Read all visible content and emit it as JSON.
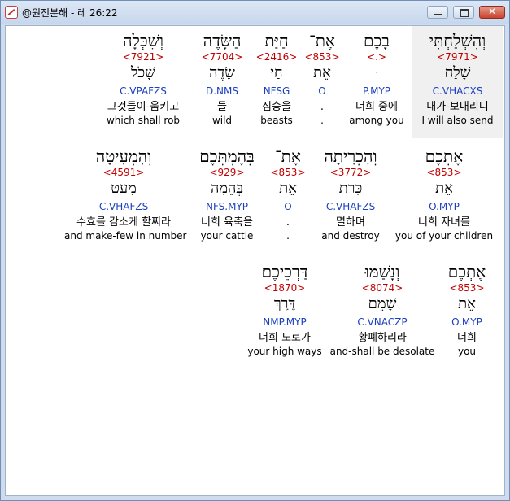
{
  "window": {
    "title": "@원전분해 - 레 26:22",
    "close_label": "✕"
  },
  "rows": [
    {
      "words": [
        {
          "heb": "וְהִשְׁלַחְתִּי",
          "strong": "<7971>",
          "lemma": "שָׁלַח",
          "morph": "C.VHACXS",
          "ko": "내가-보내리니",
          "en": "I will also send"
        },
        {
          "heb": "בָכֶם",
          "strong": "<.>",
          "lemma": "ּ",
          "morph": "P.MYP",
          "ko": "너희 중에",
          "en": "among you"
        },
        {
          "heb": "אֶת־",
          "strong": "<853>",
          "lemma": "אֵת",
          "morph": "O",
          "ko": ".",
          "en": "."
        },
        {
          "heb": "חַיַּת",
          "strong": "<2416>",
          "lemma": "חַי",
          "morph": "NFSG",
          "ko": "짐승을",
          "en": "beasts"
        },
        {
          "heb": "הַשָּׂדֶה",
          "strong": "<7704>",
          "lemma": "שָׂדֶה",
          "morph": "D.NMS",
          "ko": "들",
          "en": "wild"
        },
        {
          "heb": "וְשִׁכְּלָה",
          "strong": "<7921>",
          "lemma": "שָׁכֹל",
          "morph": "C.VPAFZS",
          "ko": "그것들이-움키고",
          "en": "which shall rob"
        }
      ]
    },
    {
      "words": [
        {
          "heb": "אֶתְכֶם",
          "strong": "<853>",
          "lemma": "אֵת",
          "morph": "O.MYP",
          "ko": "너희 자녀를",
          "en": "you of your children"
        },
        {
          "heb": "וְהִכְרִיתָה",
          "strong": "<3772>",
          "lemma": "כָּרַת",
          "morph": "C.VHAFZS",
          "ko": "멸하며",
          "en": "and destroy"
        },
        {
          "heb": "אֶת־",
          "strong": "<853>",
          "lemma": "אֵת",
          "morph": "O",
          "ko": ".",
          "en": "."
        },
        {
          "heb": "בְּהֶמְתְּכֶם",
          "strong": "<929>",
          "lemma": "בְּהֵמָה",
          "morph": "NFS.MYP",
          "ko": "너희 육축을",
          "en": "your cattle"
        },
        {
          "heb": "וְהִמְעִיטָה",
          "strong": "<4591>",
          "lemma": "מָעַט",
          "morph": "C.VHAFZS",
          "ko": "수효를 감소케 할찌라",
          "en": "and make-few in number"
        }
      ]
    },
    {
      "words": [
        {
          "heb": "אֶתְכֶם",
          "strong": "<853>",
          "lemma": "אֵת",
          "morph": "O.MYP",
          "ko": "너희",
          "en": "you"
        },
        {
          "heb": "וְנָשַׁמּוּ",
          "strong": "<8074>",
          "lemma": "שָׁמֵם",
          "morph": "C.VNACZP",
          "ko": "황폐하리라",
          "en": "and-shall be desolate"
        },
        {
          "heb": "דַּרְכֵיכֶם׃",
          "strong": "<1870>",
          "lemma": "דֶּרֶךְ",
          "morph": "NMP.MYP",
          "ko": "너희 도로가",
          "en": "your high ways"
        }
      ]
    }
  ]
}
